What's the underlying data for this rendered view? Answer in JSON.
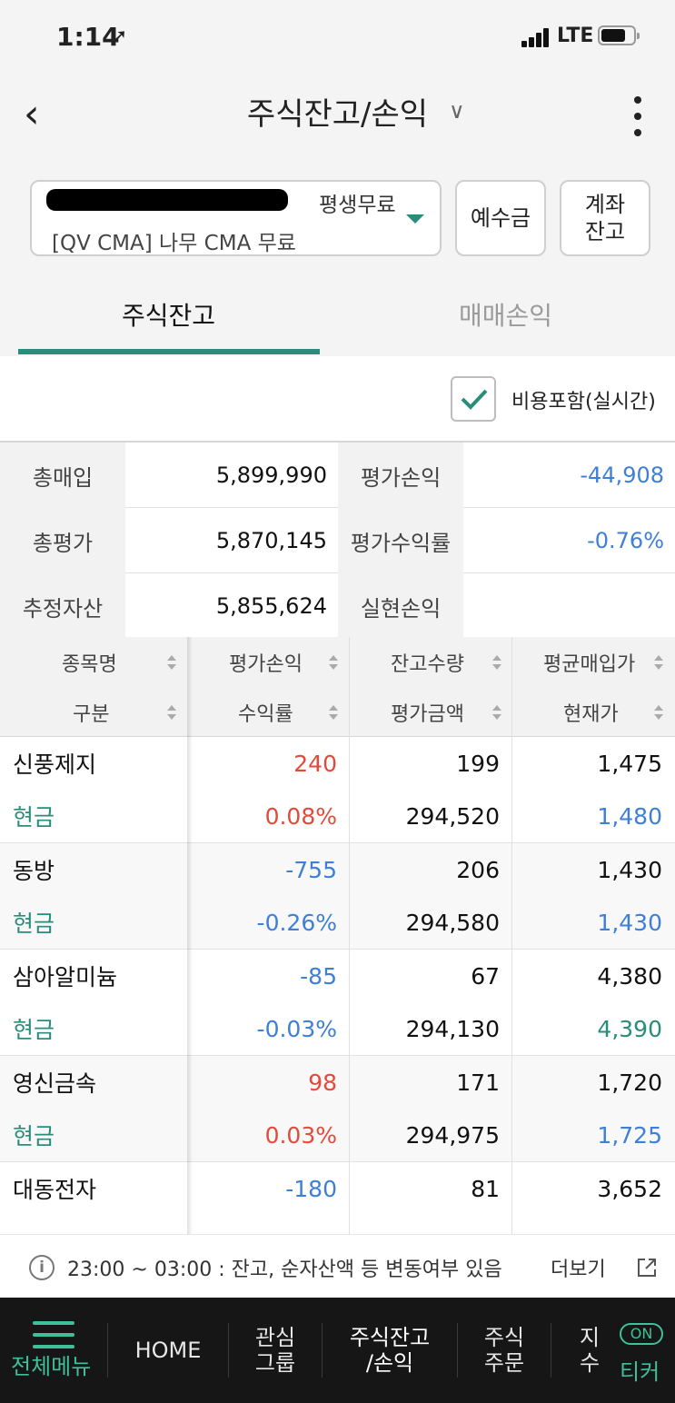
{
  "status": {
    "time": "1:14",
    "network": "LTE"
  },
  "header": {
    "title": "주식잔고/손익"
  },
  "account": {
    "plan": "평생무료",
    "name": "[QV CMA]  나무 CMA 무료"
  },
  "buttons": {
    "deposit": "예수금",
    "account_balance_1": "계좌",
    "account_balance_2": "잔고"
  },
  "tabs": [
    {
      "label": "주식잔고",
      "active": true
    },
    {
      "label": "매매손익",
      "active": false
    }
  ],
  "fee_toggle": {
    "label": "비용포함(실시간)",
    "checked": true
  },
  "summary": [
    {
      "label1": "총매입",
      "value1": "5,899,990",
      "label2": "평가손익",
      "value2": "-44,908"
    },
    {
      "label1": "총평가",
      "value1": "5,870,145",
      "label2": "평가수익률",
      "value2": "-0.76%"
    },
    {
      "label1": "추정자산",
      "value1": "5,855,624",
      "label2": "실현손익",
      "value2": ""
    }
  ],
  "table_headers": {
    "row1": [
      "종목명",
      "평가손익",
      "잔고수량",
      "평균매입가"
    ],
    "row2": [
      "구분",
      "수익률",
      "평가금액",
      "현재가"
    ]
  },
  "holdings": [
    {
      "name": "신풍제지",
      "type": "현금",
      "pnl": "240",
      "rate": "0.08%",
      "qty": "199",
      "eval": "294,520",
      "avg": "1,475",
      "cur": "1,480",
      "pnl_color": "red",
      "cur_color": "blue"
    },
    {
      "name": "동방",
      "type": "현금",
      "pnl": "-755",
      "rate": "-0.26%",
      "qty": "206",
      "eval": "294,580",
      "avg": "1,430",
      "cur": "1,430",
      "pnl_color": "blue",
      "cur_color": "blue"
    },
    {
      "name": "삼아알미늄",
      "type": "현금",
      "pnl": "-85",
      "rate": "-0.03%",
      "qty": "67",
      "eval": "294,130",
      "avg": "4,380",
      "cur": "4,390",
      "pnl_color": "blue",
      "cur_color": "green"
    },
    {
      "name": "영신금속",
      "type": "현금",
      "pnl": "98",
      "rate": "0.03%",
      "qty": "171",
      "eval": "294,975",
      "avg": "1,720",
      "cur": "1,725",
      "pnl_color": "red",
      "cur_color": "blue"
    },
    {
      "name": "대동전자",
      "type": "",
      "pnl": "-180",
      "rate": "",
      "qty": "81",
      "eval": "",
      "avg": "3,652",
      "cur": "",
      "pnl_color": "blue",
      "cur_color": "blue"
    }
  ],
  "notice": {
    "text": "23:00 ~ 03:00 : 잔고, 순자산액 등 변동여부 있음",
    "more": "더보기"
  },
  "bottom_nav": {
    "menu": "전체메뉴",
    "home": "HOME",
    "watch_1": "관심",
    "watch_2": "그룹",
    "stock_balance_1": "주식잔고",
    "stock_balance_2": "/손익",
    "stock_order_1": "주식",
    "stock_order_2": "주문",
    "index_partial": "지수",
    "ticker_on": "ON",
    "ticker": "티커"
  },
  "colors": {
    "accent": "#2a8c7a",
    "up": "#e34a3a",
    "down": "#3f7fd6",
    "nav_bg": "#161616"
  }
}
